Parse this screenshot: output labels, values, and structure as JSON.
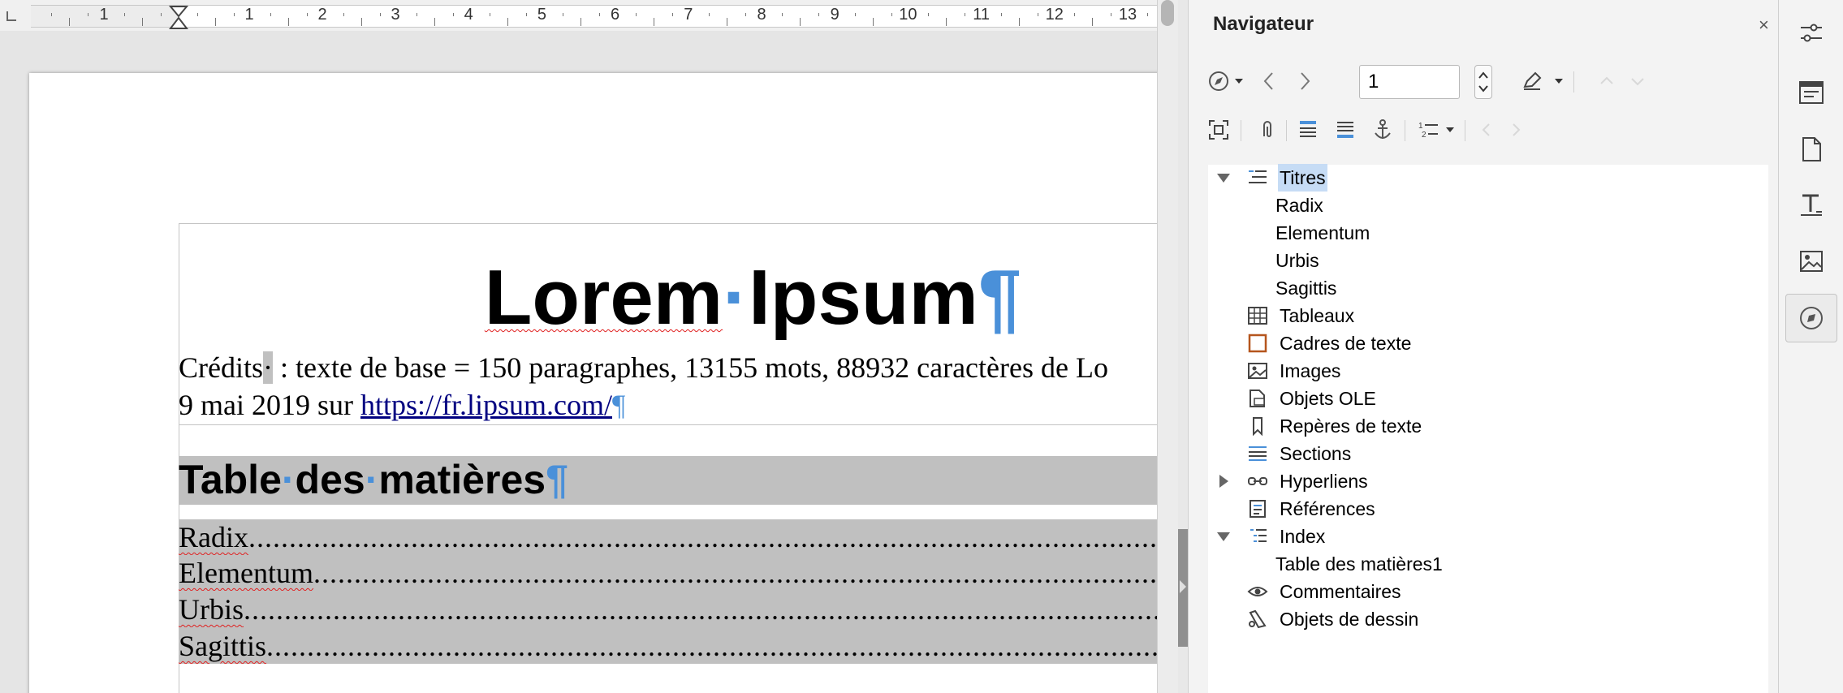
{
  "ruler": {
    "numbers": [
      "1",
      "1",
      "2",
      "3",
      "4",
      "5",
      "6",
      "7",
      "8",
      "9",
      "10",
      "11",
      "12",
      "13"
    ]
  },
  "document": {
    "title_word1": "Lorem",
    "title_word2": "Ipsum",
    "pilcrow": "¶",
    "credits_line1_pre": "Crédits",
    "credits_line1_rest": " : texte de base = 150 paragraphes, 13155 mots, 88932 caractères de Lo",
    "credits_line2_pre": "9 mai 2019 sur ",
    "credits_link": "https://fr.lipsum.com/",
    "toc_heading_word1": "Table",
    "toc_heading_word2": "des",
    "toc_heading_word3": "matières",
    "toc_entries": [
      "Radix",
      "Elementum",
      "Urbis",
      "Sagittis"
    ],
    "toc_leader": "..............................................................................................................................................................................................."
  },
  "navigator": {
    "title": "Navigateur",
    "close_glyph": "×",
    "page_number": "1",
    "tree": [
      {
        "label": "Titres",
        "expanded": true,
        "selected": true,
        "icon": "headings-icon"
      },
      {
        "label": "Radix",
        "child": true
      },
      {
        "label": "Elementum",
        "child": true
      },
      {
        "label": "Urbis",
        "child": true
      },
      {
        "label": "Sagittis",
        "child": true
      },
      {
        "label": "Tableaux",
        "icon": "table-icon"
      },
      {
        "label": "Cadres de texte",
        "icon": "text-frame-icon"
      },
      {
        "label": "Images",
        "icon": "image-icon"
      },
      {
        "label": "Objets OLE",
        "icon": "ole-object-icon"
      },
      {
        "label": "Repères de texte",
        "icon": "bookmark-icon"
      },
      {
        "label": "Sections",
        "icon": "sections-icon"
      },
      {
        "label": "Hyperliens",
        "collapsed": true,
        "icon": "hyperlink-icon"
      },
      {
        "label": "Références",
        "icon": "references-icon"
      },
      {
        "label": "Index",
        "expanded": true,
        "icon": "index-icon"
      },
      {
        "label": "Table des matières1",
        "child": true
      },
      {
        "label": "Commentaires",
        "icon": "comment-icon"
      },
      {
        "label": "Objets de dessin",
        "icon": "drawing-object-icon"
      }
    ]
  },
  "colors": {
    "accent": "#4a90d9",
    "selection": "#c6dcf5",
    "field_shading": "#c0c0c0",
    "link": "#000080",
    "spellcheck": "#e02020"
  }
}
